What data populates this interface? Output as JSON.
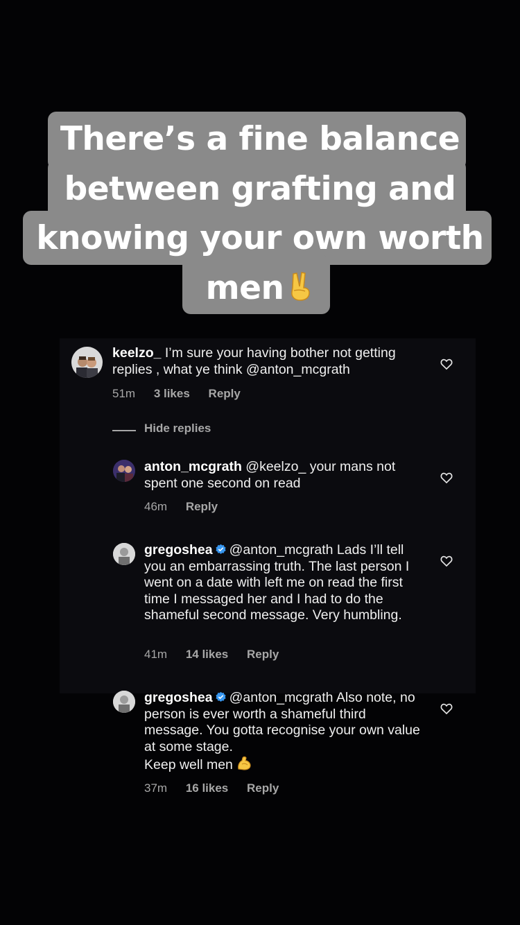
{
  "caption": {
    "lines": [
      "There’s a fine balance",
      "between grafting and",
      "knowing your own worth",
      "men"
    ],
    "emoji": "victory-hand-emoji"
  },
  "comments_panel": {
    "hide_replies_label": "Hide replies",
    "comments": [
      {
        "username": "keelzo_",
        "text": "I’m sure your having bother not getting replies , what ye think @anton_mcgrath",
        "time": "51m",
        "likes": "3 likes",
        "reply_label": "Reply"
      },
      {
        "username": "anton_mcgrath",
        "text": "@keelzo_ your mans not spent one second on read",
        "time": "46m",
        "likes": "",
        "reply_label": "Reply"
      },
      {
        "username": "gregoshea",
        "verified": true,
        "text": "@anton_mcgrath Lads I’ll tell you an embarrassing truth. The last person I went on a date with left me on read the first time I messaged her and I had to do the shameful second message. Very humbling.",
        "time": "41m",
        "likes": "14 likes",
        "reply_label": "Reply"
      },
      {
        "username": "gregoshea",
        "verified": true,
        "text": "@anton_mcgrath Also note, no person is ever worth a shameful third message. You gotta recognise your own value at some stage.",
        "text_line2": "Keep well men",
        "emoji": "flexed-biceps-emoji",
        "time": "37m",
        "likes": "16 likes",
        "reply_label": "Reply"
      }
    ]
  },
  "colors": {
    "background": "#030305",
    "caption_bg": "#8a8a8a",
    "verified_blue": "#3897f0",
    "meta_grey": "#a7a7a7"
  }
}
